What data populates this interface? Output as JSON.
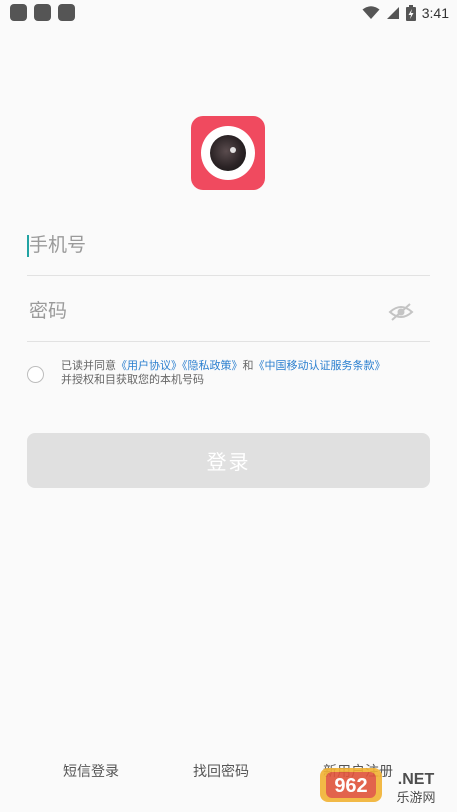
{
  "status_bar": {
    "time": "3:41"
  },
  "login": {
    "phone_placeholder": "手机号",
    "password_placeholder": "密码",
    "agreement": {
      "prefix": "已读并同意",
      "link_user": "《用户协议》",
      "link_privacy": "《隐私政策》",
      "conjunction": "和",
      "link_cmcc": "《中国移动认证服务条款》",
      "suffix": "并授权和目获取您的本机号码"
    },
    "login_label": "登录"
  },
  "footer": {
    "sms_login": "短信登录",
    "recover_password": "找回密码",
    "register": "新用户注册"
  },
  "watermark": {
    "brand": "962.NET",
    "subtitle": "乐游网"
  },
  "colors": {
    "brand": "#f04a5f",
    "link": "#2a7fcf",
    "button_disabled": "#e0e0e0",
    "caret": "#22a3a3"
  }
}
